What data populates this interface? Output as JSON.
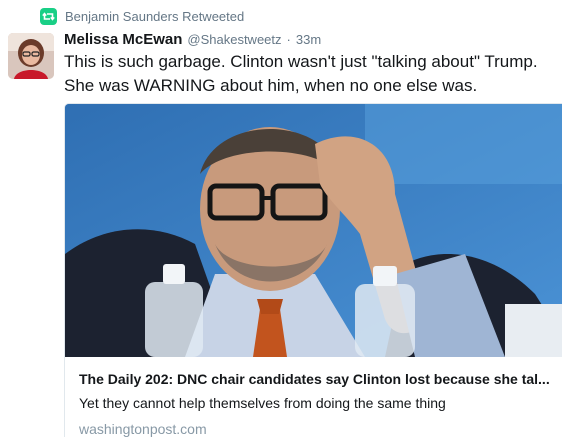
{
  "retweet": {
    "text": "Benjamin Saunders Retweeted",
    "icon": "retweet-icon",
    "color": "#19cf86"
  },
  "author": {
    "display_name": "Melissa McEwan",
    "handle": "@Shakestweetz",
    "separator": "·",
    "timestamp": "33m"
  },
  "tweet": {
    "text": "This is such garbage. Clinton wasn't just \"talking about\" Trump. She was WARNING about him, when no one else was."
  },
  "card": {
    "title": "The Daily 202: DNC chair candidates say Clinton lost because she tal...",
    "description": "Yet they cannot help themselves from doing the same thing",
    "domain": "washingtonpost.com",
    "image_subject": "man-with-glasses-hand-on-head-photo"
  },
  "colors": {
    "text": "#14171a",
    "secondary": "#657786",
    "domain": "#8899a6",
    "border": "#e1e8ed"
  }
}
